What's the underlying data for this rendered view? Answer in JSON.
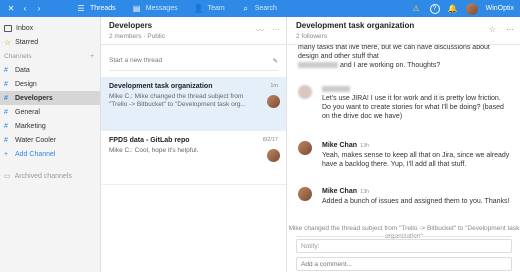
{
  "colors": {
    "topbar": "#2e8ae6",
    "accent": "#2e8ae6",
    "selected_thread": "#e4eff9"
  },
  "topbar": {
    "nav": [
      {
        "label": "Threads",
        "icon": "threads-icon"
      },
      {
        "label": "Messages",
        "icon": "messages-icon"
      },
      {
        "label": "Team",
        "icon": "team-icon"
      },
      {
        "label": "Search",
        "icon": "search-icon"
      }
    ],
    "user_name": "WinOptix"
  },
  "sidebar": {
    "top_items": [
      {
        "label": "Inbox",
        "icon": "inbox-icon"
      },
      {
        "label": "Starred",
        "icon": "star-icon"
      }
    ],
    "channels_label": "Channels",
    "channels": [
      "Data",
      "Design",
      "Developers",
      "General",
      "Marketing",
      "Water Cooler"
    ],
    "active_channel": "Developers",
    "add_channel": "Add Channel",
    "archived": "Archived channels"
  },
  "middle": {
    "title": "Developers",
    "subtitle": "2 members · Public",
    "new_thread_placeholder": "Start a new thread",
    "threads": [
      {
        "title": "Development task organization",
        "snippet": "Mike C.: Mike changed the thread subject from \"Trello -> Bitbucket\" to \"Development task org...",
        "time": "1m"
      },
      {
        "title": "FPDS data - GitLab repo",
        "snippet": "Mike C.: Cool, hope it's helpful.",
        "time": "8/2/17"
      }
    ]
  },
  "right": {
    "title": "Development task organization",
    "subtitle": "2 followers",
    "partial_top": "many tasks that live there, but we can have discussions about design and other stuff that",
    "partial_tail": "and I are working on. Thoughts?",
    "msg1": "Let's use JIRA! I use it for work and it is pretty low friction. Do you want to create stories for what I'll be doing? (based on the drive doc we have)",
    "msg2": {
      "author": "Mike Chan",
      "time": "13h",
      "text": "Yeah, makes sense to keep all that on Jira, since we already have a backlog there. Yup, I'll add all that stuff."
    },
    "msg3": {
      "author": "Mike Chan",
      "time": "13h",
      "text": "Added a bunch of issues and assigned them to you. Thanks!"
    },
    "system_note": "Mike changed the thread subject from \"Trello -> Bitbucket\" to \"Development task organization\"",
    "notify_label": "Notify:",
    "comment_placeholder": "Add a comment..."
  }
}
